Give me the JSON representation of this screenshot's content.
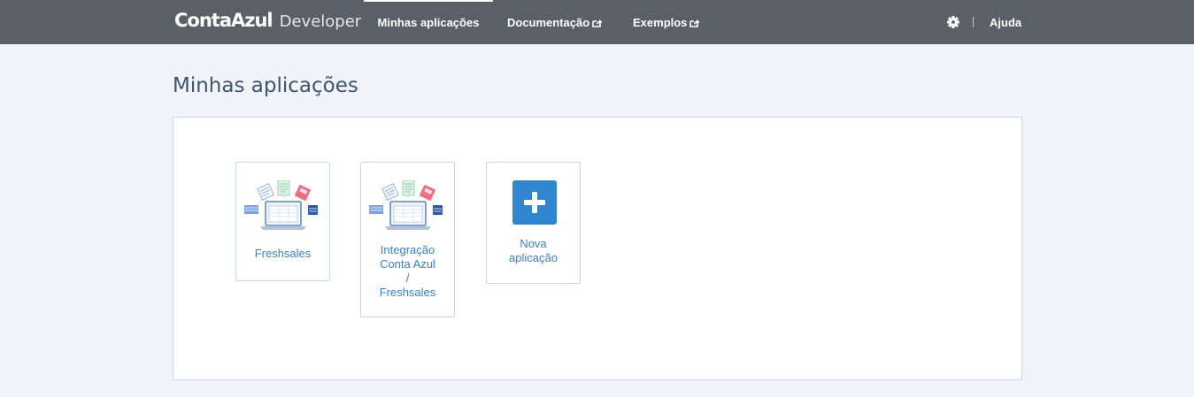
{
  "header": {
    "brand": "ContaAzul",
    "brand_sub": "Developer",
    "nav": [
      {
        "label": "Minhas aplicações",
        "active": true,
        "external": false
      },
      {
        "label": "Documentação",
        "active": false,
        "external": true
      },
      {
        "label": "Exemplos",
        "active": false,
        "external": true
      }
    ],
    "settings_icon": "gear-icon",
    "help_label": "Ajuda"
  },
  "main": {
    "title": "Minhas aplicações",
    "apps": [
      {
        "name": "Freshsales",
        "icon": "integration-illustration"
      },
      {
        "name": "Integração Conta Azul / Freshsales",
        "name_lines": [
          "Integração",
          "Conta Azul",
          "/",
          "Freshsales"
        ],
        "icon": "integration-illustration"
      }
    ],
    "new_app": {
      "label": "Nova aplicação",
      "label_lines": [
        "Nova",
        "aplicação"
      ],
      "icon": "plus-icon"
    }
  },
  "colors": {
    "header_bg": "#5a6068",
    "page_bg": "#f0f3f7",
    "accent": "#2f86cf",
    "link": "#3d7fc1",
    "title": "#3d566e"
  }
}
